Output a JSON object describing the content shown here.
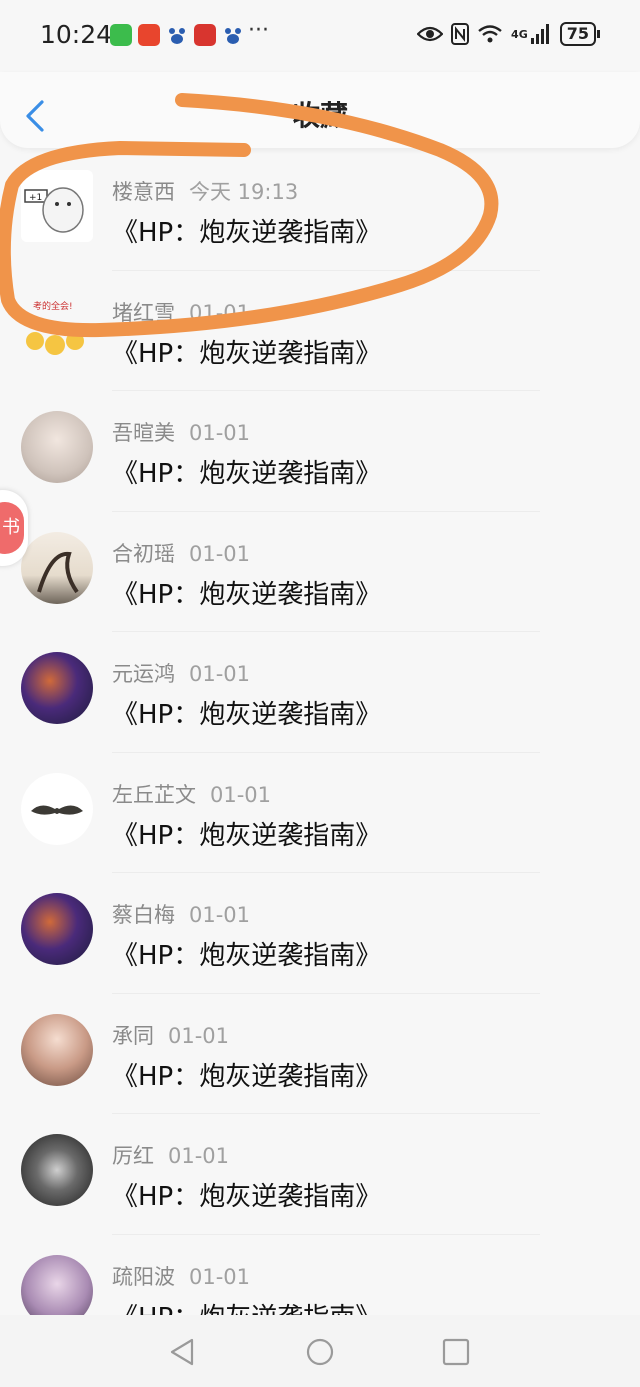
{
  "status_bar": {
    "time": "10:24",
    "network": "4G",
    "battery": "75",
    "icons": [
      "wechat-icon",
      "taobao-icon",
      "baidu-icon",
      "app-red-icon",
      "baidu-icon",
      "more-dots-icon",
      "eye-icon",
      "nfc-icon",
      "wifi-icon",
      "signal-icon",
      "battery-icon"
    ]
  },
  "header": {
    "title": "收藏",
    "back_icon": "chevron-left-icon"
  },
  "favorites": [
    {
      "name": "楼意西",
      "date": "今天 19:13",
      "work": "《HP：炮灰逆袭指南》"
    },
    {
      "name": "堵红雪",
      "date": "01-01",
      "work": "《HP：炮灰逆袭指南》"
    },
    {
      "name": "吾暄美",
      "date": "01-01",
      "work": "《HP：炮灰逆袭指南》"
    },
    {
      "name": "合初瑶",
      "date": "01-01",
      "work": "《HP：炮灰逆袭指南》"
    },
    {
      "name": "元运鸿",
      "date": "01-01",
      "work": "《HP：炮灰逆袭指南》"
    },
    {
      "name": "左丘芷文",
      "date": "01-01",
      "work": "《HP：炮灰逆袭指南》"
    },
    {
      "name": "蔡白梅",
      "date": "01-01",
      "work": "《HP：炮灰逆袭指南》"
    },
    {
      "name": "承同",
      "date": "01-01",
      "work": "《HP：炮灰逆袭指南》"
    },
    {
      "name": "厉红",
      "date": "01-01",
      "work": "《HP：炮灰逆袭指南》"
    },
    {
      "name": "疏阳波",
      "date": "01-01",
      "work": "《HP：炮灰逆袭指南》"
    }
  ],
  "side_bubble": {
    "label": "书"
  },
  "nav_bar": {
    "icons": [
      "back-triangle-icon",
      "home-circle-icon",
      "recents-square-icon"
    ]
  },
  "colors": {
    "accent_blue": "#3a8ee6",
    "annotation_orange": "#f0944a",
    "bubble_red": "#ef6b6b"
  }
}
